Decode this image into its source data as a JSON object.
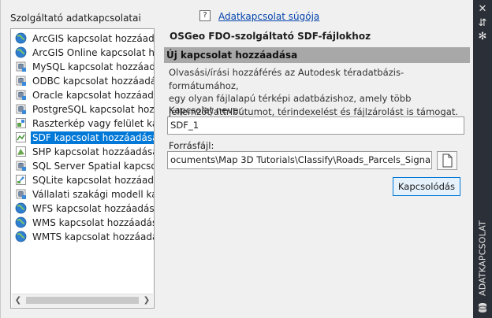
{
  "left_panel": {
    "title": "Szolgáltató adatkapcsolatai",
    "items": [
      {
        "label": "ArcGIS kapcsolat hozzáadása",
        "icon": "globe-icon"
      },
      {
        "label": "ArcGIS Online kapcsolat hozzá",
        "icon": "globe-icon"
      },
      {
        "label": "MySQL kapcsolat hozzáadása",
        "icon": "database-icon"
      },
      {
        "label": "ODBC kapcsolat hozzáadása",
        "icon": "database-icon"
      },
      {
        "label": "Oracle kapcsolat hozzáadása",
        "icon": "database-icon"
      },
      {
        "label": "PostgreSQL kapcsolat hozzáa",
        "icon": "database-icon"
      },
      {
        "label": "Raszterkép vagy felület kapcs",
        "icon": "raster-icon"
      },
      {
        "label": "SDF kapcsolat hozzáadása",
        "icon": "sdf-icon",
        "selected": true
      },
      {
        "label": "SHP kapcsolat hozzáadása",
        "icon": "shp-icon"
      },
      {
        "label": "SQL Server Spatial kapcsolat h",
        "icon": "database-icon"
      },
      {
        "label": "SQLite kapcsolat hozzáadása",
        "icon": "sqlite-icon"
      },
      {
        "label": "Vállalati szakági modell kapcs",
        "icon": "database-icon"
      },
      {
        "label": "WFS kapcsolat hozzáadása",
        "icon": "globe-icon"
      },
      {
        "label": "WMS kapcsolat hozzáadása",
        "icon": "globe-icon"
      },
      {
        "label": "WMTS kapcsolat hozzáadása",
        "icon": "globe-icon"
      }
    ]
  },
  "help": {
    "icon_text": "?",
    "link": "Adatkapcsolat súgója"
  },
  "right_panel": {
    "provider_title": "OSGeo FDO-szolgáltató SDF-fájlokhoz",
    "section_title": "Új kapcsolat hozzáadása",
    "description_lines": [
      "Olvasási/írási hozzáférés az Autodesk téradatbázis-formátumához,",
      "egy olyan fájlalapú térképi adatbázishoz, amely több",
      "jellemzőt/attribútumot, térindexelést és fájlzárolást is támogat."
    ],
    "name_label": "Kapcsolat neve:",
    "name_value": "SDF_1",
    "source_label": "Forrásfájl:",
    "source_value": "ocuments\\Map 3D Tutorials\\Classify\\Roads_Parcels_Signals.sdf",
    "connect_button": "Kapcsolódás"
  },
  "side_strip": {
    "title": "ADATKAPCSOLAT",
    "buttons": [
      "✕",
      "⇵",
      "✻"
    ]
  }
}
